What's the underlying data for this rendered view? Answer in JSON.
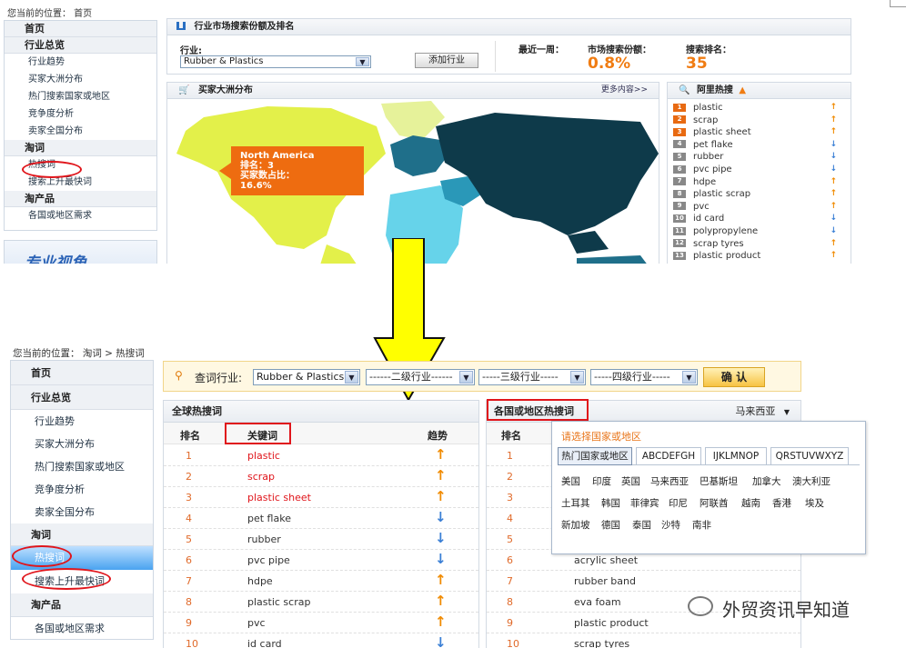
{
  "top": {
    "breadcrumb": "您当前的位置： 首页",
    "nav": {
      "home": "首页",
      "group1": "行业总览",
      "items1": [
        "行业趋势",
        "买家大洲分布",
        "热门搜索国家或地区",
        "竞争度分析",
        "卖家全国分布"
      ],
      "group2": "淘词",
      "items2": [
        "热搜词",
        "搜索上升最快词"
      ],
      "group3": "淘产品",
      "items3": [
        "各国或地区需求"
      ],
      "promo": "专业视角"
    },
    "market": {
      "title": "行业市场搜索份额及排名",
      "industry_label": "行业:",
      "industry_value": "Rubber & Plastics",
      "add_button": "添加行业",
      "period_label": "最近一周：",
      "share_label": "市场搜索份额：",
      "share_value": "0.8%",
      "rank_label": "搜索排名：",
      "rank_value": "35"
    },
    "map": {
      "title": "买家大洲分布",
      "more": "更多内容>>",
      "tooltip_region": "North America",
      "tooltip_rank": "排名：3",
      "tooltip_share_label": "买家数占比：",
      "tooltip_share_value": "16.6%"
    },
    "hot": {
      "title": "阿里热搜",
      "items": [
        {
          "n": "1",
          "term": "plastic",
          "trend": "up"
        },
        {
          "n": "2",
          "term": "scrap",
          "trend": "up"
        },
        {
          "n": "3",
          "term": "plastic sheet",
          "trend": "up"
        },
        {
          "n": "4",
          "term": "pet flake",
          "trend": "down"
        },
        {
          "n": "5",
          "term": "rubber",
          "trend": "down"
        },
        {
          "n": "6",
          "term": "pvc pipe",
          "trend": "down"
        },
        {
          "n": "7",
          "term": "hdpe",
          "trend": "up"
        },
        {
          "n": "8",
          "term": "plastic scrap",
          "trend": "up"
        },
        {
          "n": "9",
          "term": "pvc",
          "trend": "up"
        },
        {
          "n": "10",
          "term": "id card",
          "trend": "down"
        },
        {
          "n": "11",
          "term": "polypropylene",
          "trend": "down"
        },
        {
          "n": "12",
          "term": "scrap tyres",
          "trend": "up"
        },
        {
          "n": "13",
          "term": "plastic product",
          "trend": "up"
        }
      ]
    }
  },
  "bottom": {
    "breadcrumb": "您当前的位置： 淘词 > 热搜词",
    "nav": {
      "home": "首页",
      "group1": "行业总览",
      "items1": [
        "行业趋势",
        "买家大洲分布",
        "热门搜索国家或地区",
        "竞争度分析",
        "卖家全国分布"
      ],
      "group2": "淘词",
      "items2": [
        "热搜词",
        "搜索上升最快词"
      ],
      "group3": "淘产品",
      "items3": [
        "各国或地区需求"
      ]
    },
    "query": {
      "label": "查词行业:",
      "level1": "Rubber & Plastics",
      "level2": "------二级行业------",
      "level3": "-----三级行业-----",
      "level4": "-----四级行业-----",
      "confirm": "确 认"
    },
    "global": {
      "title": "全球热搜词",
      "col_rank": "排名",
      "col_keyword": "关键词",
      "col_trend": "趋势",
      "rows": [
        {
          "rank": "1",
          "keyword": "plastic",
          "trend": "up"
        },
        {
          "rank": "2",
          "keyword": "scrap",
          "trend": "up"
        },
        {
          "rank": "3",
          "keyword": "plastic sheet",
          "trend": "up"
        },
        {
          "rank": "4",
          "keyword": "pet flake",
          "trend": "down"
        },
        {
          "rank": "5",
          "keyword": "rubber",
          "trend": "down"
        },
        {
          "rank": "6",
          "keyword": "pvc pipe",
          "trend": "down"
        },
        {
          "rank": "7",
          "keyword": "hdpe",
          "trend": "up"
        },
        {
          "rank": "8",
          "keyword": "plastic scrap",
          "trend": "up"
        },
        {
          "rank": "9",
          "keyword": "pvc",
          "trend": "up"
        },
        {
          "rank": "10",
          "keyword": "id card",
          "trend": "down"
        }
      ]
    },
    "country": {
      "title": "各国或地区热搜词",
      "selected": "马来西亚",
      "col_rank": "排名",
      "rows": [
        {
          "rank": "1",
          "keyword": ""
        },
        {
          "rank": "2",
          "keyword": ""
        },
        {
          "rank": "3",
          "keyword": ""
        },
        {
          "rank": "4",
          "keyword": ""
        },
        {
          "rank": "5",
          "keyword": ""
        },
        {
          "rank": "6",
          "keyword": "acrylic sheet"
        },
        {
          "rank": "7",
          "keyword": "rubber band"
        },
        {
          "rank": "8",
          "keyword": "eva foam"
        },
        {
          "rank": "9",
          "keyword": "plastic product"
        },
        {
          "rank": "10",
          "keyword": "scrap tyres"
        }
      ],
      "dropdown": {
        "prompt": "请选择国家或地区",
        "tabs": [
          "热门国家或地区",
          "ABCDEFGH",
          "IJKLMNOP",
          "QRSTUVWXYZ"
        ],
        "countries": [
          "美国",
          "印度",
          "英国",
          "马来西亚",
          "巴基斯坦",
          "加拿大",
          "澳大利亚",
          "土耳其",
          "韩国",
          "菲律宾",
          "印尼",
          "阿联酋",
          "越南",
          "香港",
          "埃及",
          "新加坡",
          "德国",
          "泰国",
          "沙特",
          "南非"
        ]
      }
    },
    "watermark": "外贸资讯早知道"
  },
  "colors": {
    "accent_orange": "#f07c12",
    "arrow_yellow": "#ffff00",
    "highlight_red": "#e0151b",
    "trend_up": "#f08a00",
    "trend_down": "#3a7fd5"
  }
}
